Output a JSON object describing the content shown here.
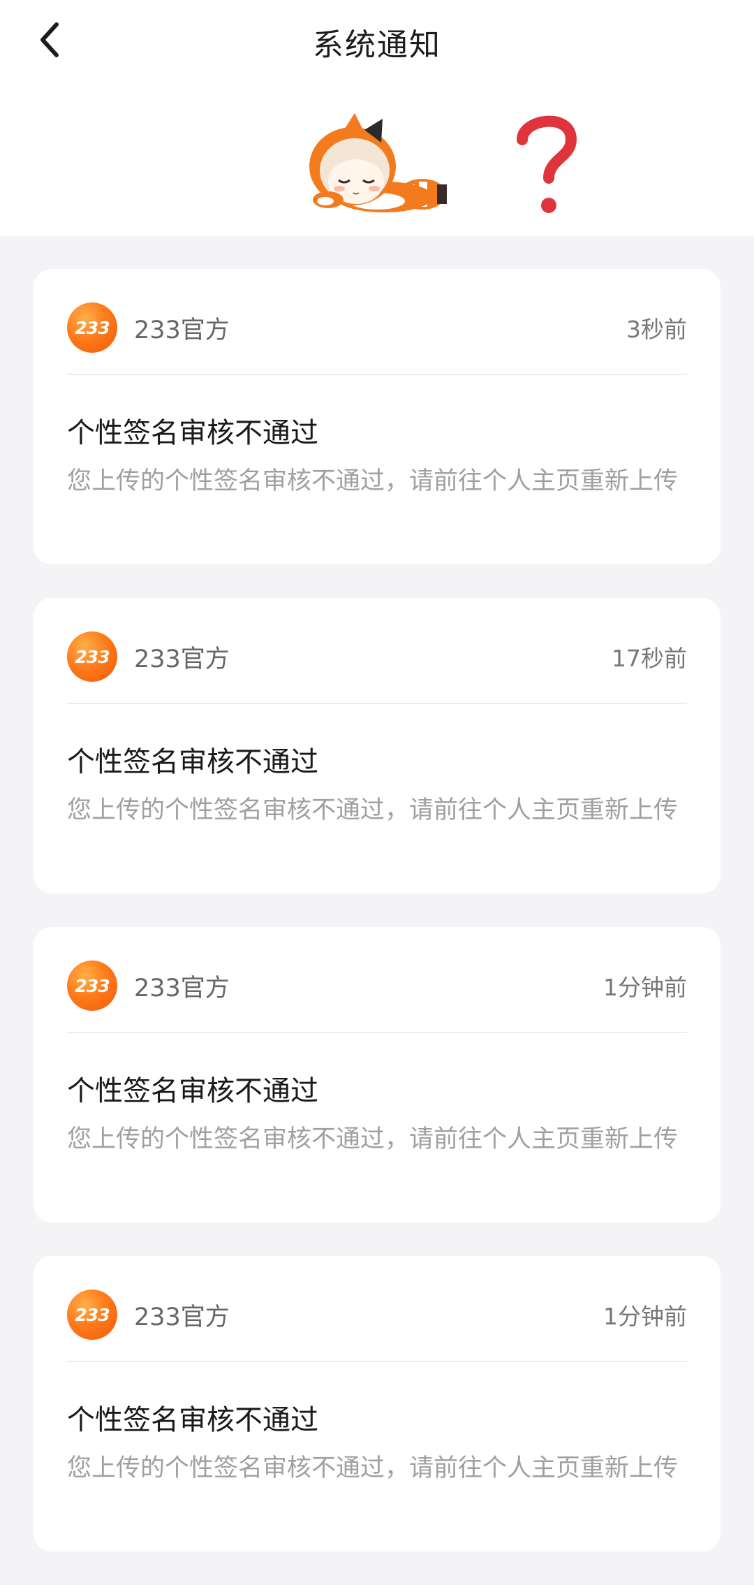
{
  "header": {
    "title": "系统通知",
    "back_icon": "chevron-left-icon"
  },
  "banner": {
    "mascot": "sleeping-mascot-illustration",
    "icon": "question-mark-icon",
    "accent_color": "#e0343c"
  },
  "notifications": [
    {
      "avatar_text": "233",
      "sender": "233官方",
      "time": "3秒前",
      "title": "个性签名审核不通过",
      "body": "您上传的个性签名审核不通过，请前往个人主页重新上传"
    },
    {
      "avatar_text": "233",
      "sender": "233官方",
      "time": "17秒前",
      "title": "个性签名审核不通过",
      "body": "您上传的个性签名审核不通过，请前往个人主页重新上传"
    },
    {
      "avatar_text": "233",
      "sender": "233官方",
      "time": "1分钟前",
      "title": "个性签名审核不通过",
      "body": "您上传的个性签名审核不通过，请前往个人主页重新上传"
    },
    {
      "avatar_text": "233",
      "sender": "233官方",
      "time": "1分钟前",
      "title": "个性签名审核不通过",
      "body": "您上传的个性签名审核不通过，请前往个人主页重新上传"
    }
  ],
  "colors": {
    "brand_orange": "#ff7a1a",
    "background": "#f4f4f6"
  }
}
